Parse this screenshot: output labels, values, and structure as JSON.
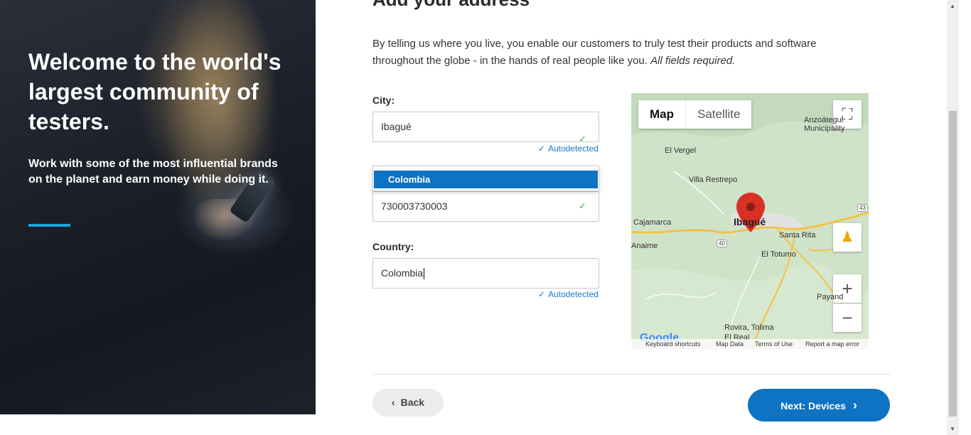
{
  "hero": {
    "title": "Welcome to the world's largest community of testers.",
    "subtitle": "Work with some of the most influential brands on the planet and earn money while doing it."
  },
  "page": {
    "heading": "Add your address",
    "intro": "By telling us where you live, you enable our customers to truly test their products and software throughout the globe - in the hands of real people like you.",
    "intro_required": "All fields required."
  },
  "form": {
    "city_label": "City:",
    "city_value": "Ibagué",
    "city_status": "Autodetected",
    "dropdown_option": "Colombia",
    "postal_value": "730003730003",
    "country_label": "Country:",
    "country_value": "Colombia",
    "country_status": "Autodetected"
  },
  "map": {
    "map_tab": "Map",
    "satellite_tab": "Satellite",
    "places": {
      "anzoategui": "Anzoátegui",
      "municipality": "Municipality",
      "el_vergel": "El Vergel",
      "villa_restrepo": "Villa Restrepo",
      "cajamarca": "Cajamarca",
      "ibague": "Ibagué",
      "santa_rita": "Santa Rita",
      "anaime": "Anaime",
      "el_totumo": "El Totumo",
      "payande": "Payand",
      "rovira": "Rovira, Tolima",
      "el_real": "El Real",
      "road_40": "40",
      "road_43": "43"
    },
    "google": "Google",
    "attribution": {
      "shortcuts": "Keyboard shortcuts",
      "map_data": "Map Data",
      "terms": "Terms of Use",
      "report": "Report a map error"
    }
  },
  "nav": {
    "back": "Back",
    "next": "Next: Devices"
  },
  "colors": {
    "primary": "#0e73c3",
    "accent_bar": "#1fa3d8",
    "success": "#3fae4a"
  }
}
